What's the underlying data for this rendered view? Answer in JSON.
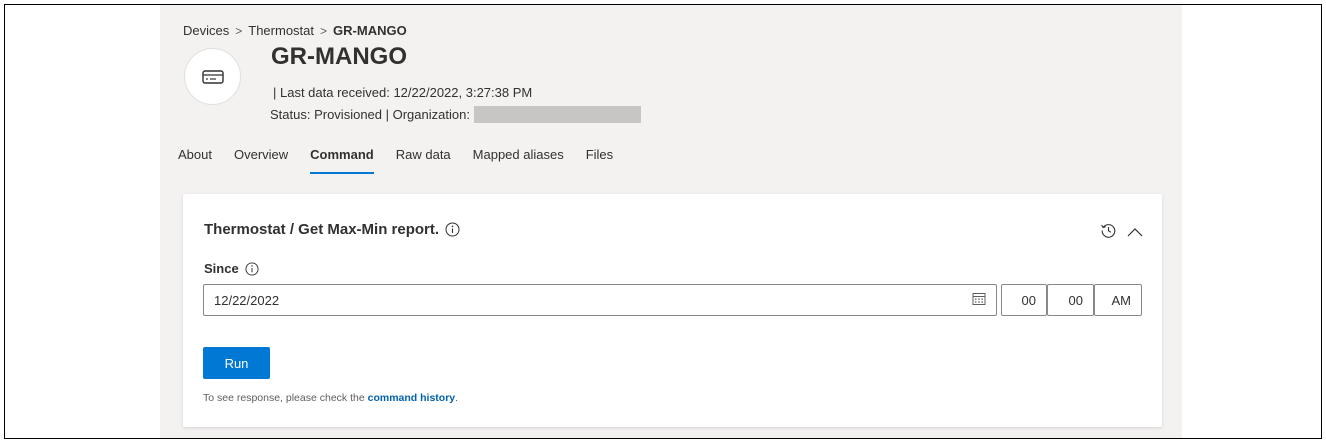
{
  "breadcrumb": {
    "items": [
      "Devices",
      "Thermostat",
      "GR-MANGO"
    ],
    "separator": ">"
  },
  "device": {
    "name": "GR-MANGO",
    "icon": "device-icon",
    "last_data": "| Last data received: 12/22/2022, 3:27:38 PM",
    "status_line": "Status: Provisioned | Organization:"
  },
  "tabs": [
    {
      "label": "About",
      "active": false
    },
    {
      "label": "Overview",
      "active": false
    },
    {
      "label": "Command",
      "active": true
    },
    {
      "label": "Raw data",
      "active": false
    },
    {
      "label": "Mapped aliases",
      "active": false
    },
    {
      "label": "Files",
      "active": false
    }
  ],
  "command": {
    "title": "Thermostat / Get Max-Min report.",
    "since_label": "Since",
    "date_value": "12/22/2022",
    "hour": "00",
    "minute": "00",
    "ampm": "AM",
    "run_label": "Run",
    "hint_prefix": "To see response, please check the ",
    "hint_link": "command history",
    "hint_suffix": "."
  },
  "colors": {
    "accent": "#0078d4",
    "page_bg": "#f3f2f1",
    "link": "#0062ad"
  }
}
